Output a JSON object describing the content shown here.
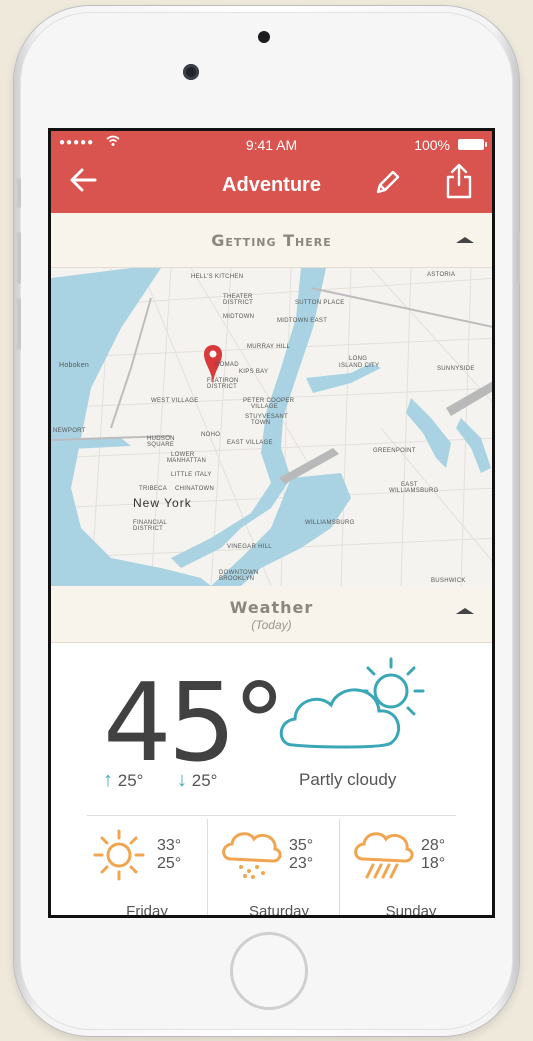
{
  "status": {
    "time": "9:41 AM",
    "battery": "100%",
    "signal": "●●●●●"
  },
  "nav": {
    "title": "Adventure"
  },
  "sections": {
    "getting_there": "Getting There",
    "weather_title": "Weather",
    "weather_sub": "(Today)"
  },
  "map": {
    "labels": [
      "Hell's Kitchen",
      "Theater District",
      "Sutton Place",
      "Astoria",
      "Midtown",
      "Midtown East",
      "Murray Hill",
      "Nomad",
      "Kips Bay",
      "Long Island City",
      "Sunnyside",
      "Hoboken",
      "Flatiron District",
      "West Village",
      "Peter Cooper Village",
      "Stuyvesant Town",
      "Noho",
      "East Village",
      "Greenpoint",
      "Newport",
      "Hudson Square",
      "Lower Manhattan",
      "Little Italy",
      "Tribeca",
      "Chinatown",
      "New York",
      "Financial District",
      "Vinegar Hill",
      "Williamsburg",
      "East Williamsburg",
      "Downtown Brooklyn",
      "Bushwick"
    ],
    "pin_color": "#d9393b",
    "water_color": "#a9d3e2"
  },
  "weather": {
    "current_temp": "45°",
    "high": "25°",
    "low": "25°",
    "condition": "Partly cloudy",
    "accent": "#3aa7b7",
    "forecast": [
      {
        "day": "Friday",
        "hi": "33°",
        "lo": "25°",
        "icon": "sun-icon"
      },
      {
        "day": "Saturday",
        "hi": "35°",
        "lo": "23°",
        "icon": "snow-cloud-icon"
      },
      {
        "day": "Sunday",
        "hi": "28°",
        "lo": "18°",
        "icon": "rain-cloud-icon"
      }
    ]
  },
  "colors": {
    "header": "#d9534f",
    "section_bg": "#f8f4ec",
    "forecast_icon": "#f2a550"
  }
}
